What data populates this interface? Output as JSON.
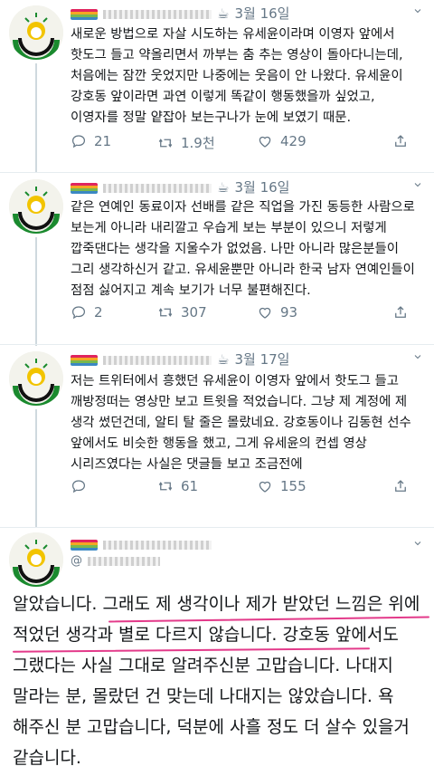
{
  "tweets": [
    {
      "date": "3월 16일",
      "cup": "☕",
      "text": "새로운 방법으로 자살 시도하는 유세윤이라며 이영자 앞에서 핫도그 들고 약올리면서 까부는 춤 추는 영상이 돌아다니는데, 처음에는 잠깐 웃었지만 나중에는 웃음이 안 나왔다. 유세윤이 강호동 앞이라면 과연 이렇게 똑같이 행동했을까 싶었고, 이영자를 정말 얕잡아 보는구나가 눈에 보였기 때문.",
      "replies": "21",
      "retweets": "1.9천",
      "likes": "429"
    },
    {
      "date": "3월 16일",
      "cup": "☕",
      "text": "같은 연예인 동료이자 선배를 같은 직업을 가진 동등한 사람으로 보는게 아니라 내리깔고 우습게 보는 부분이 있으니 저렇게 깝죽댄다는 생각을 지울수가 없었음. 나만 아니라 많은분들이 그리 생각하신거 같고. 유세윤뿐만 아니라 한국 남자 연예인들이 점점 싫어지고 계속 보기가 너무 불편해진다.",
      "replies": "2",
      "retweets": "307",
      "likes": "93"
    },
    {
      "date": "3월 17일",
      "cup": "☕",
      "text": "저는 트위터에서 흥했던 유세윤이 이영자 앞에서 핫도그 들고 깨방정떠는 영상만 보고 트윗을 적었습니다. 그냥 제 계정에 제 생각 썼던건데, 알티 탈 줄은 몰랐네요. 강호동이나 김동현 선수 앞에서도 비슷한 행동을 했고, 그게 유세윤의 컨셉 영상 시리즈였다는 사실은 댓글들 보고 조금전에",
      "replies": "",
      "retweets": "61",
      "likes": "155"
    }
  ],
  "reply": {
    "handle": "@",
    "text": "알았습니다. 그래도 제 생각이나 제가 받았던 느낌은 위에 적었던 생각과 별로 다르지 않습니다. 강호동 앞에서도 그랬다는 사실 그대로 알려주신분 고맙습니다. 나대지 말라는 분, 몰랐던 건 맞는데 나대지는 않았습니다. 욕 해주신 분 고맙습니다, 덕분에 사흘 정도 더 살수 있을거 같습니다."
  },
  "icons": {
    "reply": "reply-icon",
    "retweet": "retweet-icon",
    "like": "heart-icon",
    "share": "share-icon",
    "menu": "chevron-down-icon"
  },
  "colors": {
    "avatar_green": "#1a8a2e",
    "avatar_yellow": "#f2c400",
    "underline": "#e33a8a"
  }
}
